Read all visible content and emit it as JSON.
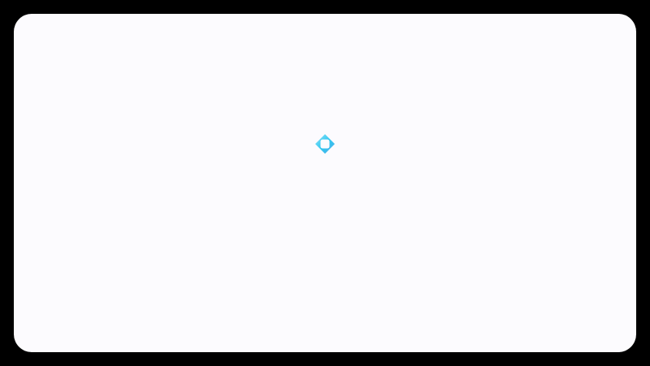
{
  "app": {
    "state": "loading",
    "background_color": "#fcfbfe",
    "frame_color": "#000000"
  },
  "loader": {
    "icon": "loading-spinner-icon",
    "colors": {
      "primary": "#2ec5f0",
      "secondary": "#5aa9e6",
      "light": "#8fe3f8"
    }
  }
}
